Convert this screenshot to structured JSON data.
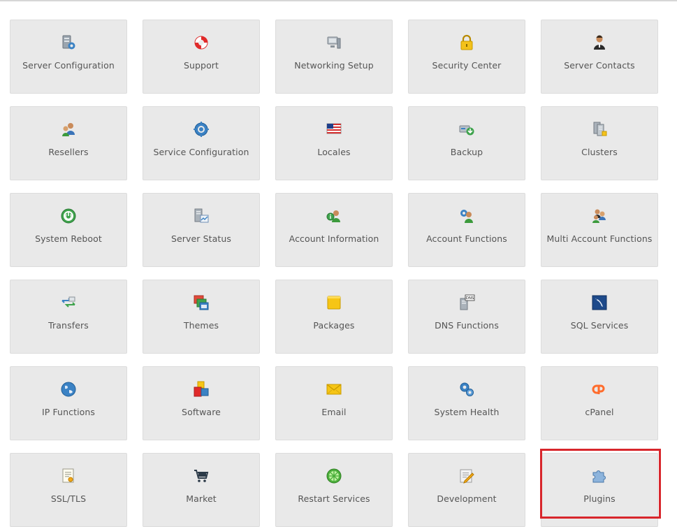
{
  "tiles": [
    {
      "label": "Server Configuration",
      "icon": "server-gear-icon"
    },
    {
      "label": "Support",
      "icon": "lifebuoy-icon"
    },
    {
      "label": "Networking Setup",
      "icon": "network-computer-icon"
    },
    {
      "label": "Security Center",
      "icon": "padlock-icon"
    },
    {
      "label": "Server Contacts",
      "icon": "contact-person-icon"
    },
    {
      "label": "Resellers",
      "icon": "resellers-users-icon"
    },
    {
      "label": "Service Configuration",
      "icon": "gear-icon"
    },
    {
      "label": "Locales",
      "icon": "flag-icon"
    },
    {
      "label": "Backup",
      "icon": "backup-drive-icon"
    },
    {
      "label": "Clusters",
      "icon": "cluster-servers-icon"
    },
    {
      "label": "System Reboot",
      "icon": "power-icon"
    },
    {
      "label": "Server Status",
      "icon": "server-status-icon"
    },
    {
      "label": "Account Information",
      "icon": "account-info-icon"
    },
    {
      "label": "Account Functions",
      "icon": "account-functions-icon"
    },
    {
      "label": "Multi Account Functions",
      "icon": "multi-account-icon"
    },
    {
      "label": "Transfers",
      "icon": "transfer-arrows-icon"
    },
    {
      "label": "Themes",
      "icon": "themes-windows-icon"
    },
    {
      "label": "Packages",
      "icon": "package-box-icon"
    },
    {
      "label": "DNS Functions",
      "icon": "dns-server-icon"
    },
    {
      "label": "SQL Services",
      "icon": "sql-dolphin-icon"
    },
    {
      "label": "IP Functions",
      "icon": "globe-icon"
    },
    {
      "label": "Software",
      "icon": "software-cubes-icon"
    },
    {
      "label": "Email",
      "icon": "envelope-icon"
    },
    {
      "label": "System Health",
      "icon": "health-gears-icon"
    },
    {
      "label": "cPanel",
      "icon": "cpanel-logo-icon"
    },
    {
      "label": "SSL/TLS",
      "icon": "certificate-icon"
    },
    {
      "label": "Market",
      "icon": "shopping-cart-icon"
    },
    {
      "label": "Restart Services",
      "icon": "restart-wheel-icon"
    },
    {
      "label": "Development",
      "icon": "code-pencil-icon"
    },
    {
      "label": "Plugins",
      "icon": "puzzle-piece-icon"
    }
  ],
  "highlighted_tile": "Plugins",
  "colors": {
    "tile_bg": "#e9e9e9",
    "label_text": "#555555",
    "highlight_border": "#d8262c"
  }
}
